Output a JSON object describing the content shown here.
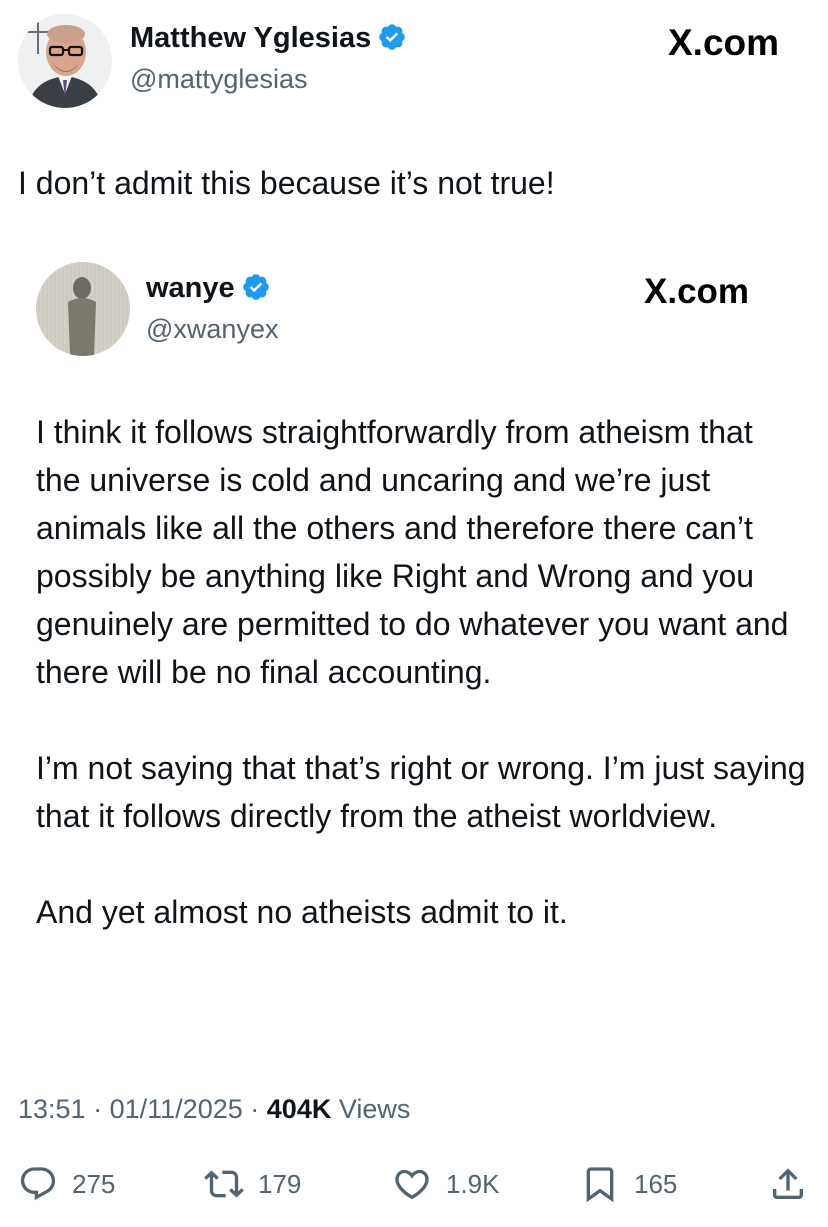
{
  "outer_tweet": {
    "author_name": "Matthew Yglesias",
    "handle": "@mattyglesias",
    "site": "X.com",
    "text": "I don’t admit this because it’s not true!"
  },
  "quoted_tweet": {
    "author_name": "wanye",
    "handle": "@xwanyex",
    "site": "X.com",
    "paragraphs": [
      "I think it follows straightforwardly from atheism that the universe is cold and uncaring and we’re just animals like all the others and therefore there can’t possibly be anything like Right and Wrong and you genuinely are permitted to do whatever you want and there will be no final accounting.",
      "I’m not saying that that’s right or wrong. I’m just saying that it follows directly from the atheist worldview.",
      "And yet almost no atheists admit to it."
    ]
  },
  "meta": {
    "time": "13:51",
    "date": "01/11/2025",
    "views_count": "404K",
    "views_label": "Views"
  },
  "actions": {
    "replies": "275",
    "reposts": "179",
    "likes": "1.9K",
    "bookmarks": "165"
  },
  "icons": [
    "verified-badge-icon",
    "reply-icon",
    "repost-icon",
    "like-icon",
    "bookmark-icon",
    "share-icon"
  ],
  "colors": {
    "verified": "#1d9bf0",
    "text": "#0f1419",
    "secondary": "#536471",
    "background": "#ffffff"
  }
}
